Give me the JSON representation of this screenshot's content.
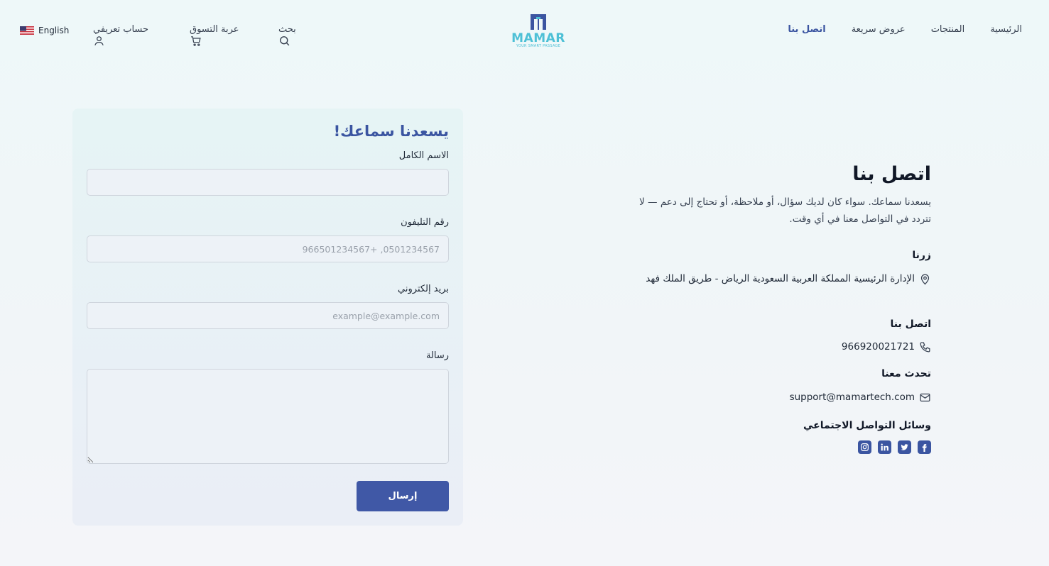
{
  "header": {
    "nav": [
      {
        "label": "الرئيسية",
        "active": false
      },
      {
        "label": "المنتجات",
        "active": false
      },
      {
        "label": "عروض سريعة",
        "active": false
      },
      {
        "label": "اتصل بنا",
        "active": true
      }
    ],
    "logo": {
      "word": "MAMAR",
      "tagline": "YOUR SMART PASSAGE"
    },
    "search_label": "بحث",
    "cart_label": "عربة التسوق",
    "account_label": "حساب تعريفي",
    "language_label": "English"
  },
  "form": {
    "title": "يسعدنا سماعك!",
    "name_label": "الاسم الكامل",
    "name_placeholder": "",
    "phone_label": "رقم التليفون",
    "phone_placeholder": "0501234567, +966501234567",
    "email_label": "بريد إلكتروني",
    "email_placeholder": "example@example.com",
    "message_label": "رسالة",
    "submit_label": "إرسال"
  },
  "info": {
    "title": "اتصل بنا",
    "description": "يسعدنا سماعك. سواء كان لديك سؤال، أو ملاحظة، أو تحتاج إلى دعم — لا تتردد في التواصل معنا في أي وقت.",
    "visit_label": "زرنا",
    "address": "الإدارة الرئيسية المملكة العربية السعودية الرياض - طريق الملك فهد",
    "call_label": "اتصل بنا",
    "phone": "966920021721",
    "chat_label": "تحدث معنا",
    "email": "support@mamartech.com",
    "social_label": "وسائل التواصل الاجتماعي",
    "social_icons": [
      "facebook-icon",
      "twitter-icon",
      "linkedin-icon",
      "instagram-icon"
    ]
  },
  "colors": {
    "accent": "#3b55a1",
    "logo": "#4dc0d6",
    "button": "#4058a6"
  }
}
